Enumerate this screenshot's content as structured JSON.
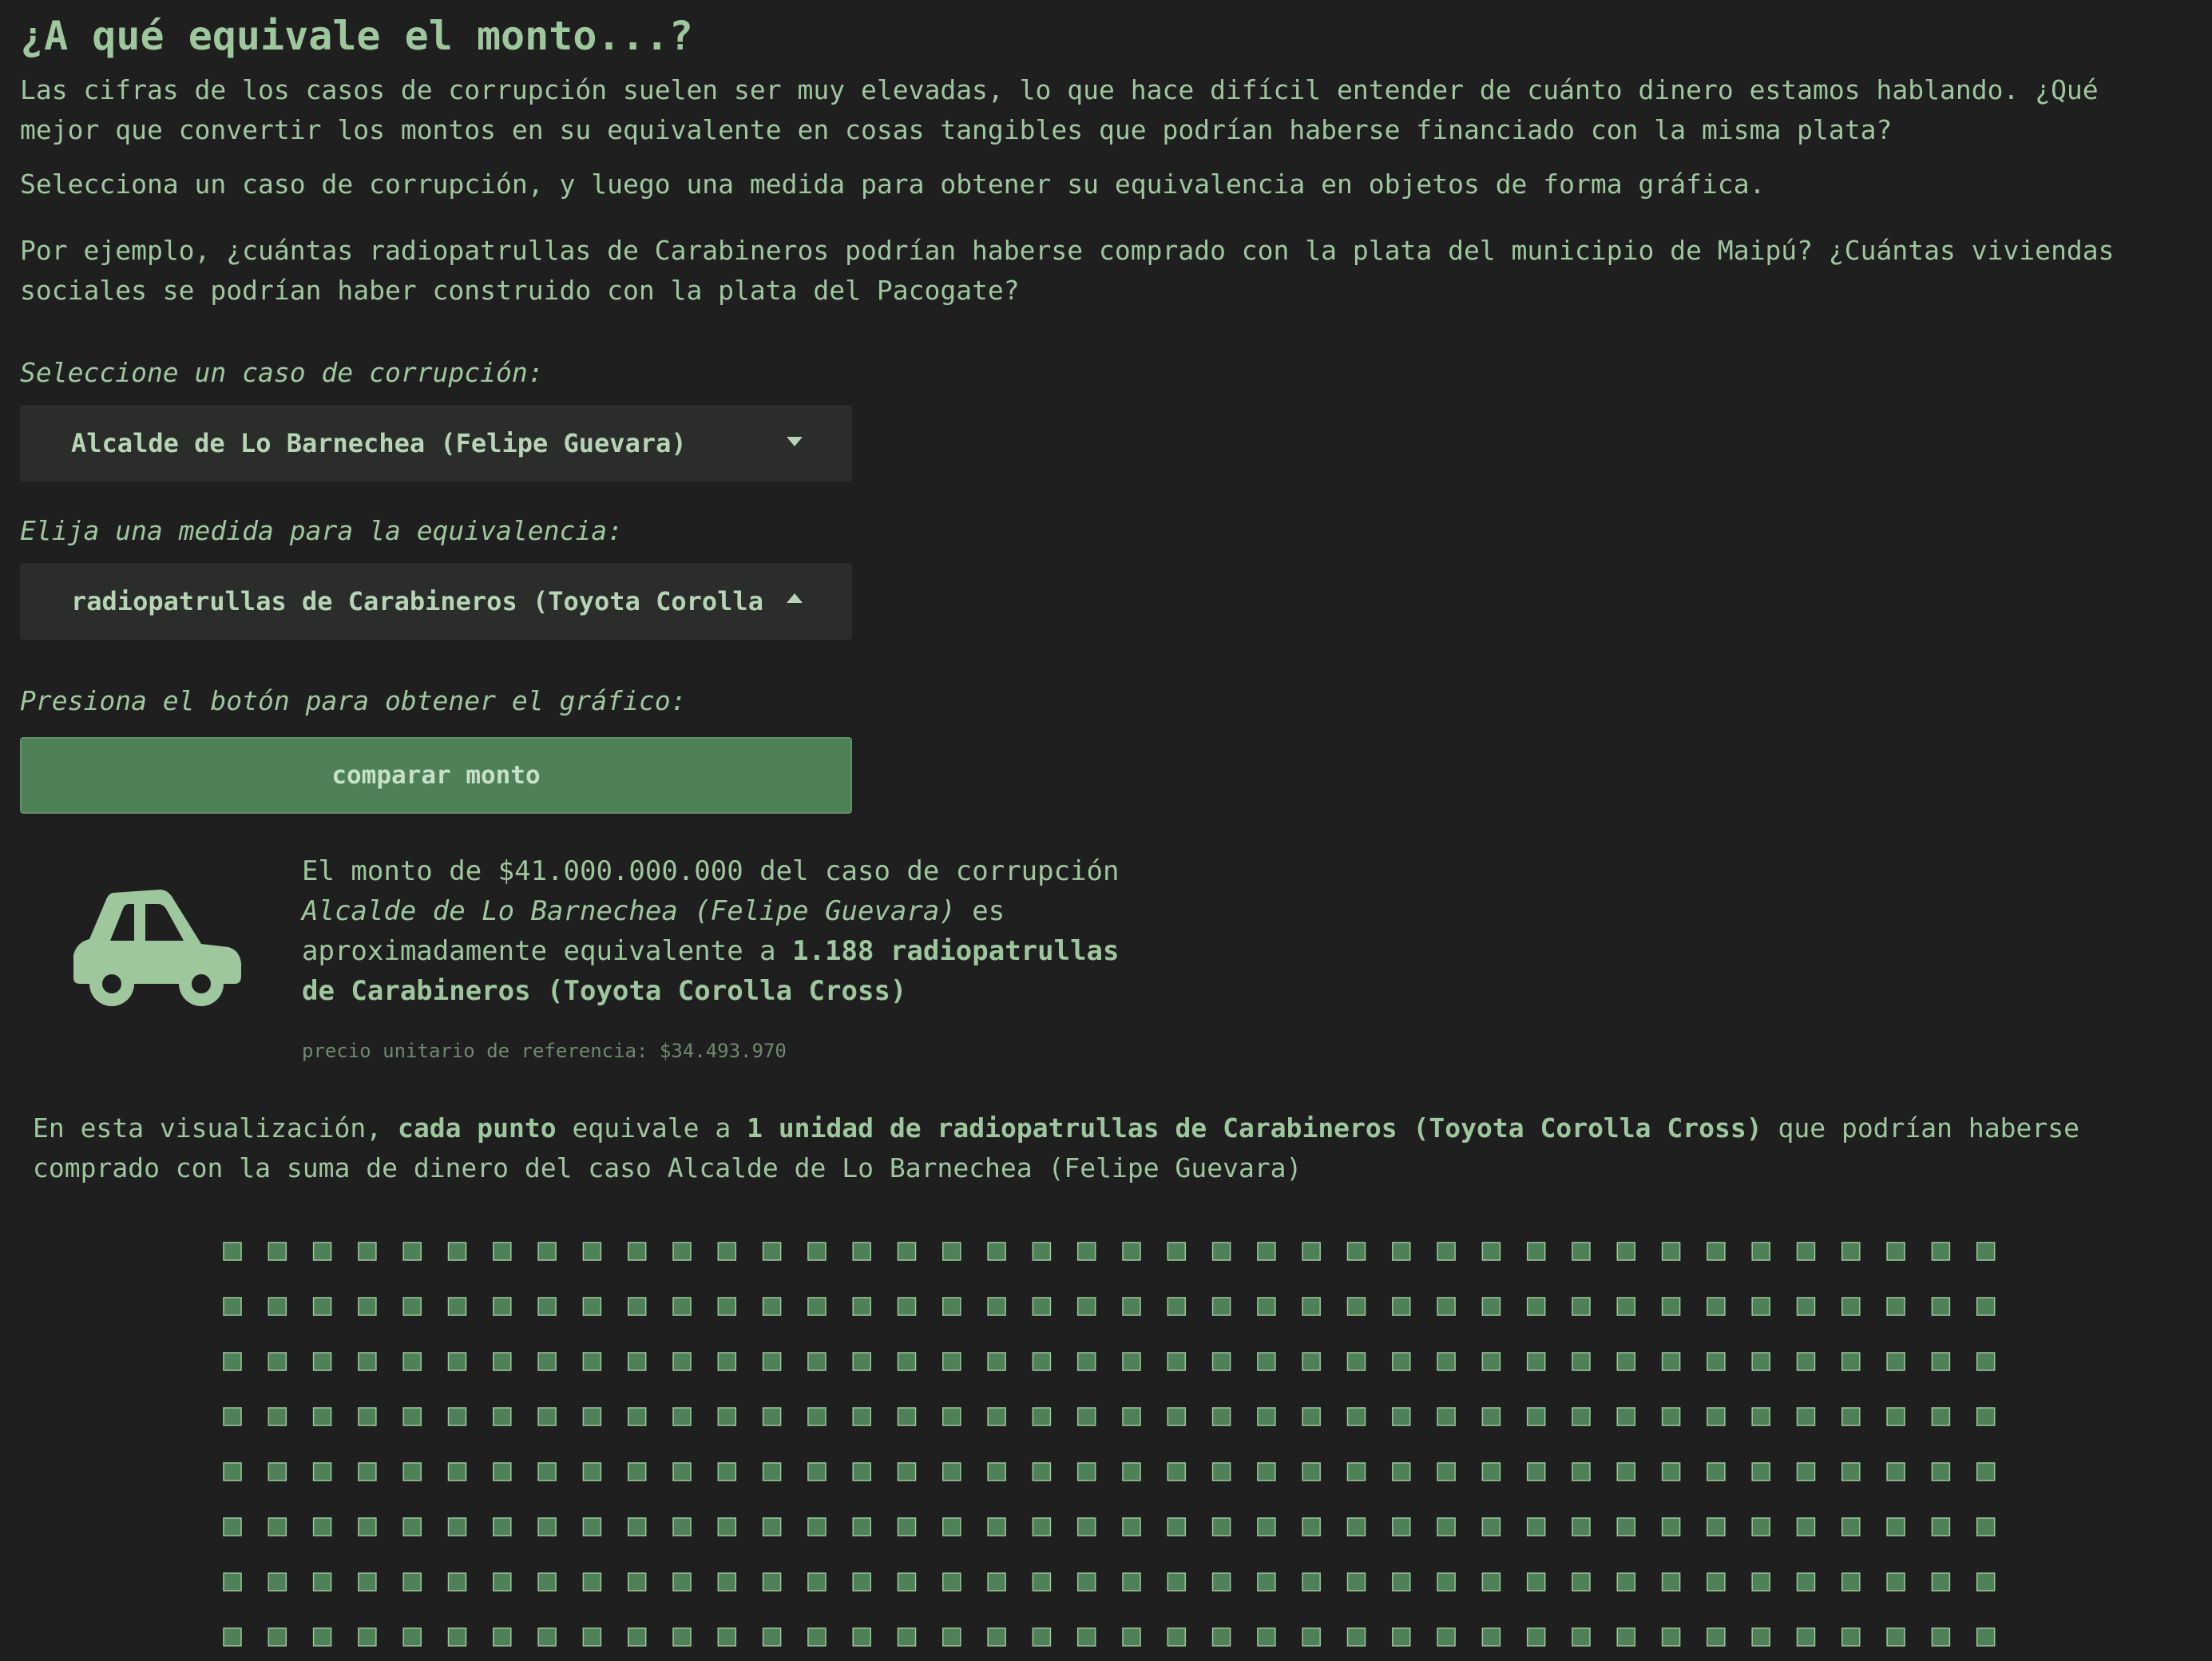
{
  "title": "¿A qué equivale el monto...?",
  "intro_paragraphs": [
    "Las cifras de los casos de corrupción suelen ser muy elevadas, lo que hace difícil entender de cuánto dinero estamos hablando. ¿Qué mejor que convertir los montos en su equivalente en cosas tangibles que podrían haberse financiado con la misma plata?",
    "Selecciona un caso de corrupción, y luego una medida para obtener su equivalencia en objetos de forma gráfica.",
    "Por ejemplo, ¿cuántas radiopatrullas de Carabineros podrían haberse comprado con la plata del municipio de Maipú? ¿Cuántas viviendas sociales se podrían haber construido con la plata del Pacogate?"
  ],
  "case_select": {
    "label": "Seleccione un caso de corrupción:",
    "value": "Alcalde de Lo Barnechea (Felipe Guevara)"
  },
  "measure_select": {
    "label": "Elija una medida para la equivalencia:",
    "value": "radiopatrullas de Carabineros (Toyota Corolla Cross)"
  },
  "action": {
    "label": "Presiona el botón para obtener el gráfico:",
    "button": "comparar monto"
  },
  "result": {
    "icon": "car-icon",
    "prefix": "El monto de ",
    "amount": "$41.000.000.000",
    "middle": " del caso de corrupción ",
    "case_name": "Alcalde de Lo Barnechea (Felipe Guevara)",
    "middle2": " es aproximadamente equivalente a ",
    "equivalence": "1.188 radiopatrullas de Carabineros (Toyota Corolla Cross)",
    "reference_price": "precio unitario de referencia: $34.493.970"
  },
  "viz": {
    "t1": "En esta visualización, ",
    "t2": "cada punto",
    "t3": " equivale a ",
    "t4": "1 unidad de radiopatrullas de Carabineros (Toyota Corolla Cross)",
    "t5": " que podrían haberse comprado con la suma de dinero del caso Alcalde de Lo Barnechea (Felipe Guevara)"
  },
  "dot_grid": {
    "total_units": 1188,
    "columns": 40,
    "visible_rows": 8,
    "dot_color": "#4e8157",
    "dot_border": "#9ec79e"
  },
  "colors": {
    "background": "#1f1f1f",
    "text": "#9ec79e",
    "accent": "#4e8157"
  }
}
